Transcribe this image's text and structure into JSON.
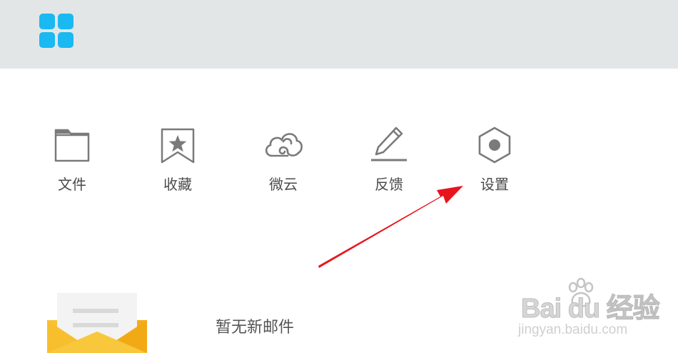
{
  "header": {
    "apps_icon": "grid-apps-icon",
    "accent_color": "#1ab9f2"
  },
  "shortcuts": [
    {
      "label": "文件",
      "icon": "folder-icon"
    },
    {
      "label": "收藏",
      "icon": "bookmark-star-icon"
    },
    {
      "label": "微云",
      "icon": "cloud-icon"
    },
    {
      "label": "反馈",
      "icon": "pencil-icon"
    },
    {
      "label": "设置",
      "icon": "settings-hexagon-icon"
    }
  ],
  "annotation": {
    "arrow_color": "#e8141b",
    "points_to": "设置"
  },
  "mail": {
    "status_text": "暂无新邮件",
    "illustration": "envelope-icon",
    "envelope_color": "#f7b500"
  },
  "watermark": {
    "brand": "Bai du 经验",
    "url": "jingyan.baidu.com"
  },
  "colors": {
    "header_bg": "#e3e6e7",
    "icon_gray": "#7a7a7a",
    "text_gray": "#4a4a4a"
  }
}
